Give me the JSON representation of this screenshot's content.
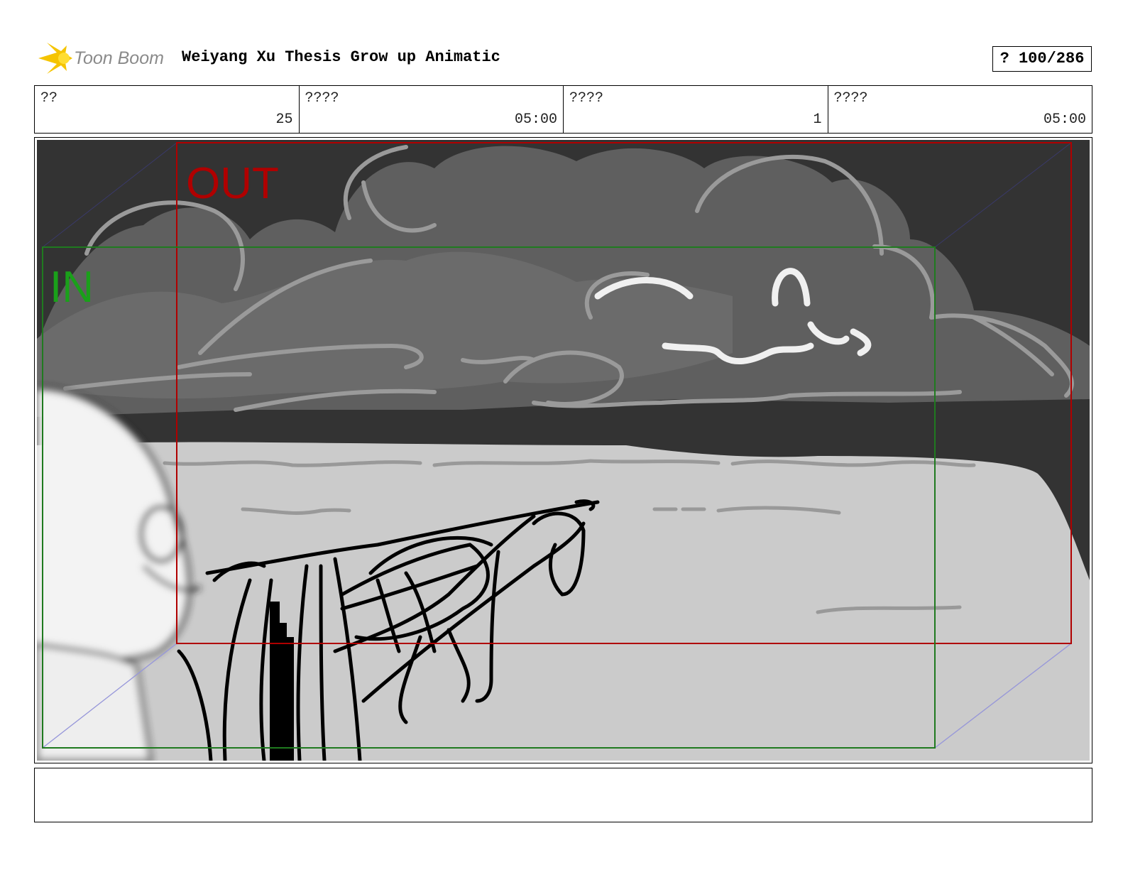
{
  "header": {
    "logo_text": "Toon Boom",
    "project_title": "Weiyang Xu Thesis Grow up Animatic",
    "page_counter": "? 100/286"
  },
  "info": [
    {
      "label": "??",
      "value": "25"
    },
    {
      "label": "????",
      "value": "05:00"
    },
    {
      "label": "????",
      "value": "1"
    },
    {
      "label": "????",
      "value": "05:00"
    }
  ],
  "panel": {
    "out_label": "OUT",
    "in_label": "IN"
  },
  "caption": {
    "text": ""
  },
  "colors": {
    "sky": "#333333",
    "clouds": "#5f5f5f",
    "ground": "#cbcbcb",
    "out_frame": "#b00000",
    "in_frame": "#1f7a1f",
    "logo_accent": "#f5c400"
  }
}
